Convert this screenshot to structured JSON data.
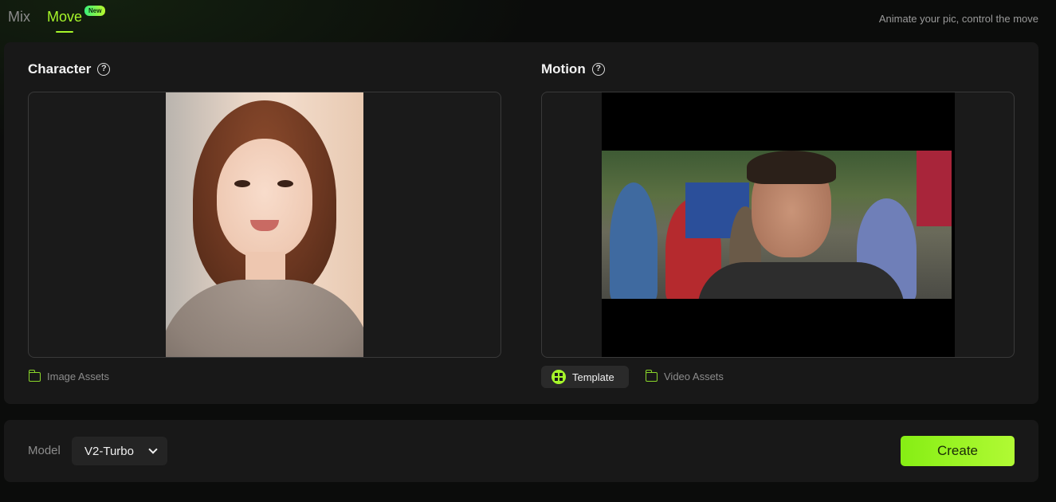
{
  "tabs": {
    "mix_label": "Mix",
    "move_label": "Move",
    "new_badge": "New"
  },
  "tagline": "Animate your pic, control the move",
  "character": {
    "title": "Character",
    "help_icon": "?",
    "image_assets_label": "Image Assets"
  },
  "motion": {
    "title": "Motion",
    "help_icon": "?",
    "template_label": "Template",
    "video_assets_label": "Video Assets"
  },
  "bottom": {
    "model_label": "Model",
    "model_value": "V2-Turbo",
    "create_label": "Create"
  },
  "colors": {
    "accent": "#a6f62a",
    "panel": "#181818",
    "background": "#0b0c0b"
  },
  "icons": [
    "help-icon",
    "folder-icon",
    "template-icon",
    "chevron-down-icon"
  ]
}
